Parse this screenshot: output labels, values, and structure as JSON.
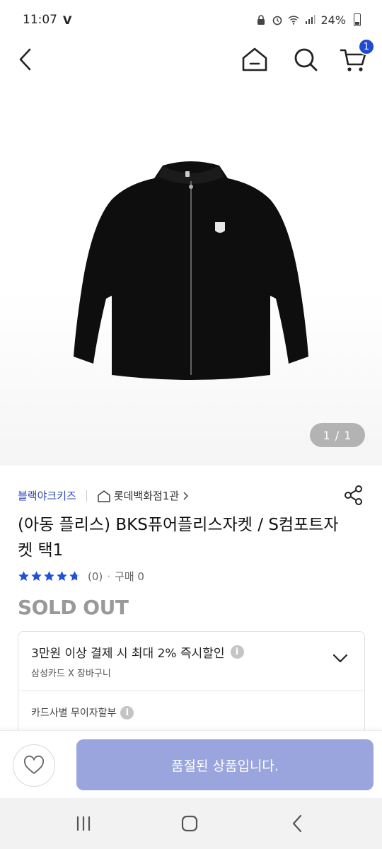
{
  "status_bar": {
    "time": "11:07",
    "carrier_mark": "V",
    "battery": "24%"
  },
  "nav": {
    "cart_count": "1"
  },
  "gallery": {
    "pager": "1 / 1"
  },
  "product": {
    "brand": "블랙야크키즈",
    "store": "롯데백화점1관",
    "title": "(아동 플리스) BKS퓨어플리스자켓 / S컴포트자켓 택1",
    "rating_count": "(0)",
    "purchase_count": "구매 0",
    "status": "SOLD OUT"
  },
  "benefits": {
    "main": "3만원 이상 결제 시 최대 2% 즉시할인",
    "sub": "삼성카드 X 장바구니",
    "installment": "카드사별 무이자할부"
  },
  "actions": {
    "soldout_label": "품절된 상품입니다."
  },
  "colors": {
    "accent": "#1f4bd1",
    "brand_text": "#2a46b8",
    "soldout_button": "#9aa5dd",
    "star": "#2350d8"
  }
}
